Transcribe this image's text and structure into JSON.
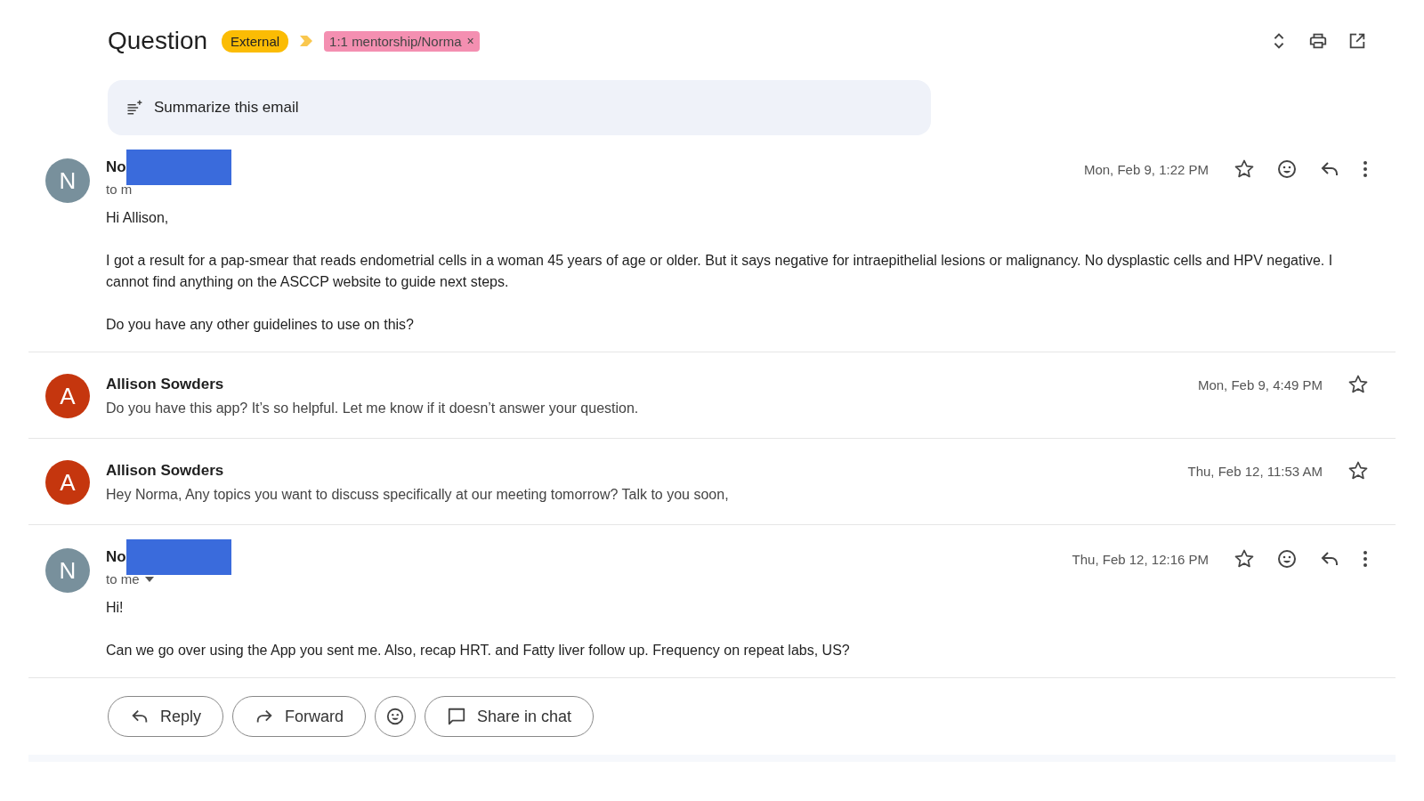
{
  "subject": "Question",
  "labels": [
    {
      "text": "External",
      "color": "#fbbc04",
      "removable": false
    },
    {
      "text": "1:1 mentorship/Norma",
      "color": "#f48fb1",
      "removable": true
    }
  ],
  "remove_mark": "×",
  "summarize": {
    "label": "Summarize this email"
  },
  "messages": [
    {
      "kind": "expanded",
      "initial": "N",
      "color": "#78909c",
      "sender": "No",
      "redacted": true,
      "to": "to m",
      "to_menu": false,
      "date": "Mon, Feb 9, 1:22 PM",
      "starred": false,
      "body": [
        "Hi Allison,",
        "I got a result for a pap-smear that reads endometrial cells in a woman 45 years of age or older. But it says negative for intraepithelial lesions or malignancy. No dysplastic cells and HPV negative. I cannot find anything on the ASCCP website to guide next steps.",
        "Do you have any other guidelines to use on this?"
      ]
    },
    {
      "kind": "collapsed",
      "initial": "A",
      "color": "#c5360e",
      "sender": "Allison Sowders",
      "date": "Mon, Feb 9, 4:49 PM",
      "starred": false,
      "snippet": "Do you have this app? It’s so helpful. Let me know if it doesn’t answer your question."
    },
    {
      "kind": "collapsed",
      "initial": "A",
      "color": "#c5360e",
      "sender": "Allison Sowders",
      "date": "Thu, Feb 12, 11:53 AM",
      "starred": false,
      "snippet": "Hey Norma, Any topics you want to discuss specifically at our meeting tomorrow? Talk to you soon,"
    },
    {
      "kind": "expanded",
      "initial": "N",
      "color": "#78909c",
      "sender": "No",
      "redacted": true,
      "to": "to me",
      "to_menu": true,
      "date": "Thu, Feb 12, 12:16 PM",
      "starred": false,
      "body": [
        "Hi!",
        "Can we go over using the App you sent me. Also, recap HRT. and Fatty liver follow up. Frequency on repeat labs, US?"
      ]
    }
  ],
  "actions": [
    {
      "kind": "reply",
      "label": "Reply"
    },
    {
      "kind": "forward",
      "label": "Forward"
    },
    {
      "kind": "emoji"
    },
    {
      "kind": "chat",
      "label": "Share in chat"
    }
  ]
}
